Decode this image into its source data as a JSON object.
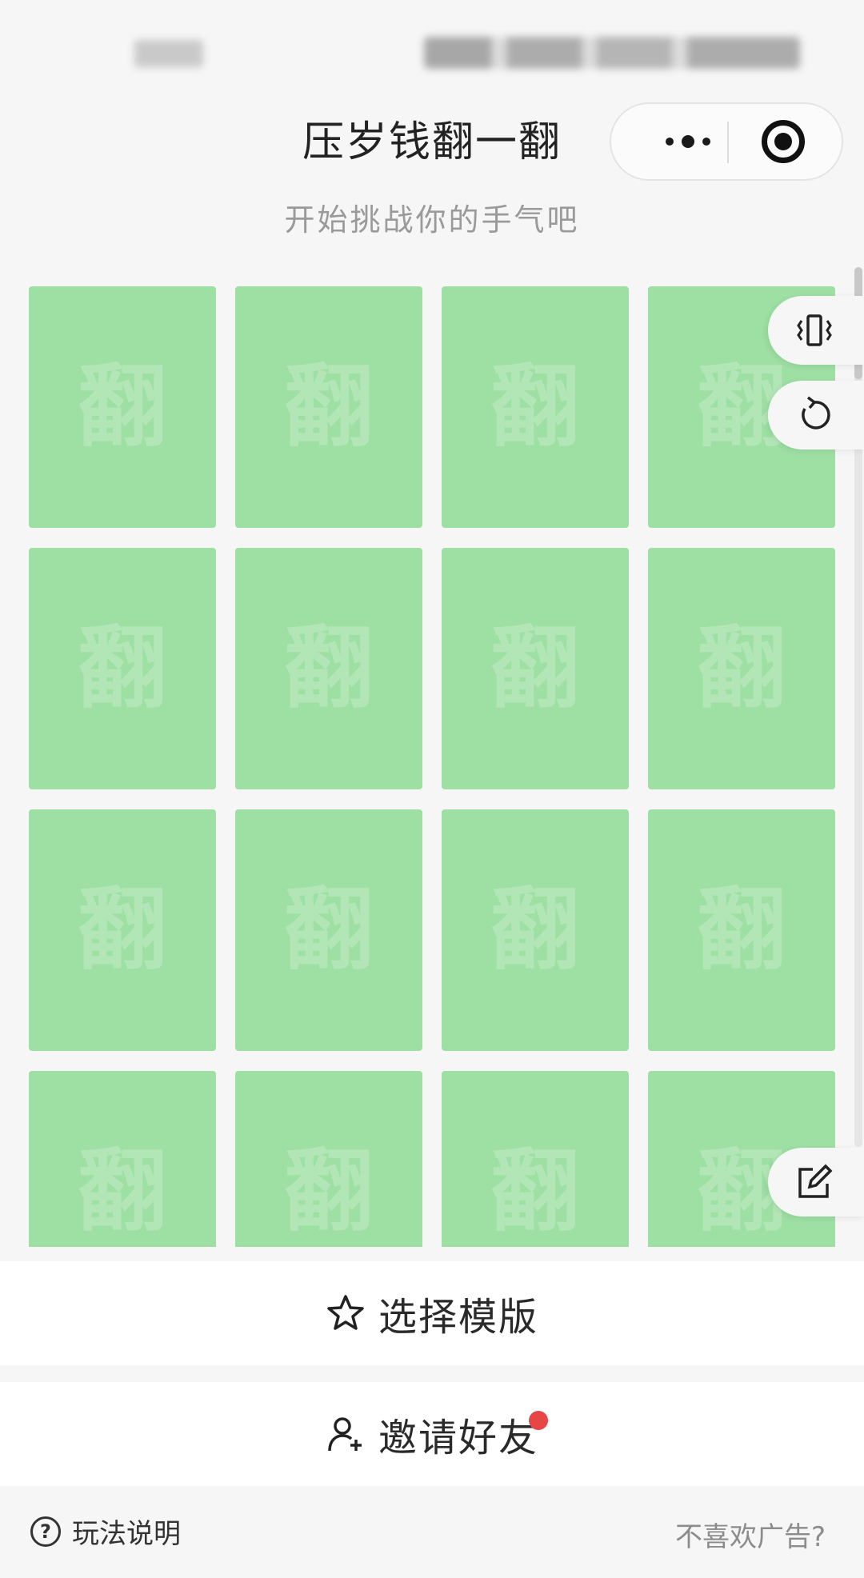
{
  "header": {
    "title": "压岁钱翻一翻",
    "subtitle": "开始挑战你的手气吧"
  },
  "capsule": {
    "more_icon": "more-dots-icon",
    "close_icon": "target-close-icon"
  },
  "grid": {
    "card_char": "翻",
    "rows": 4,
    "cols": 4,
    "card_color": "#9edfa4",
    "char_color": "#b3e6b7"
  },
  "side_buttons": [
    {
      "name": "vibrate-icon"
    },
    {
      "name": "refresh-icon"
    },
    {
      "name": "edit-icon"
    }
  ],
  "actions": {
    "choose_template": "选择模版",
    "invite_friends": "邀请好友"
  },
  "footer": {
    "help_icon": "?",
    "help_label": "玩法说明",
    "no_ads": "不喜欢广告?"
  },
  "colors": {
    "background": "#f6f6f6",
    "card": "#9edfa4",
    "badge": "#e64646"
  }
}
